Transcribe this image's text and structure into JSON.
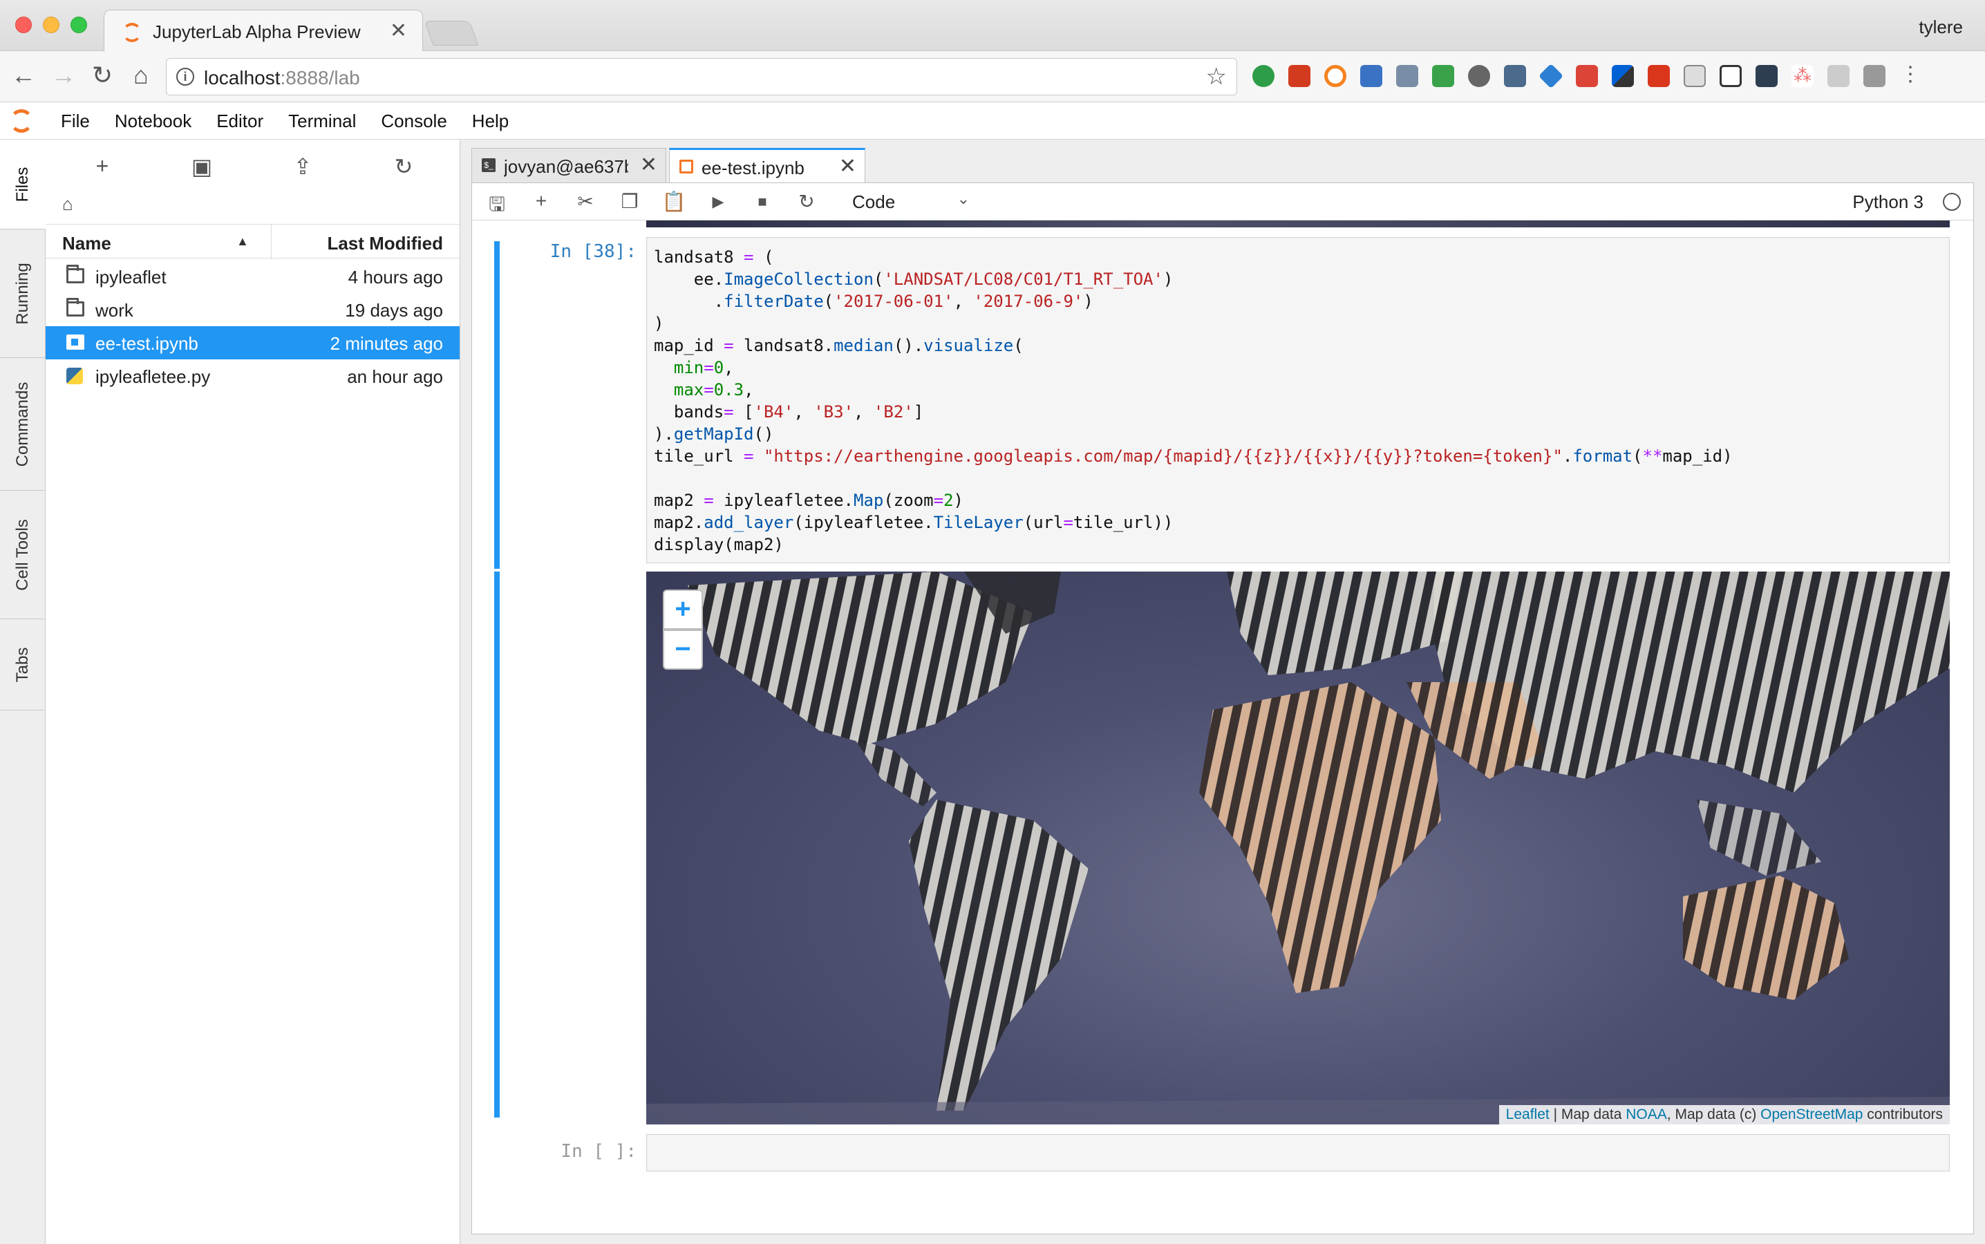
{
  "browser": {
    "tab_title": "JupyterLab Alpha Preview",
    "tab_close": "✕",
    "user": "tylere",
    "url_host": "localhost",
    "url_rest": ":8888/lab"
  },
  "menu": [
    "File",
    "Notebook",
    "Editor",
    "Terminal",
    "Console",
    "Help"
  ],
  "siderail": {
    "files": "Files",
    "running": "Running",
    "commands": "Commands",
    "cell_tools": "Cell Tools",
    "tabs": "Tabs"
  },
  "filebrowser": {
    "col_name": "Name",
    "col_modified": "Last Modified",
    "items": [
      {
        "name": "ipyleaflet",
        "modified": "4 hours ago",
        "type": "folder"
      },
      {
        "name": "work",
        "modified": "19 days ago",
        "type": "folder"
      },
      {
        "name": "ee-test.ipynb",
        "modified": "2 minutes ago",
        "type": "notebook"
      },
      {
        "name": "ipyleafletee.py",
        "modified": "an hour ago",
        "type": "python"
      }
    ]
  },
  "dock": {
    "tab_terminal": "jovyan@ae637b",
    "tab_notebook": "ee-test.ipynb",
    "close": "✕"
  },
  "notebook_toolbar": {
    "cell_type": "Code",
    "kernel": "Python 3"
  },
  "cells": {
    "prompt_1": "In [38]:",
    "prompt_2": "In [ ]:"
  },
  "map": {
    "zoom_in": "+",
    "zoom_out": "−",
    "attrib_leaflet": "Leaflet",
    "attrib_sep1": " | Map data ",
    "attrib_noaa": "NOAA",
    "attrib_sep2": ", Map data (c) ",
    "attrib_osm": "OpenStreetMap",
    "attrib_tail": " contributors"
  },
  "colors": {
    "accent": "#2196f3",
    "jupyter_orange": "#f37726",
    "prompt_blue": "#307fc1"
  }
}
